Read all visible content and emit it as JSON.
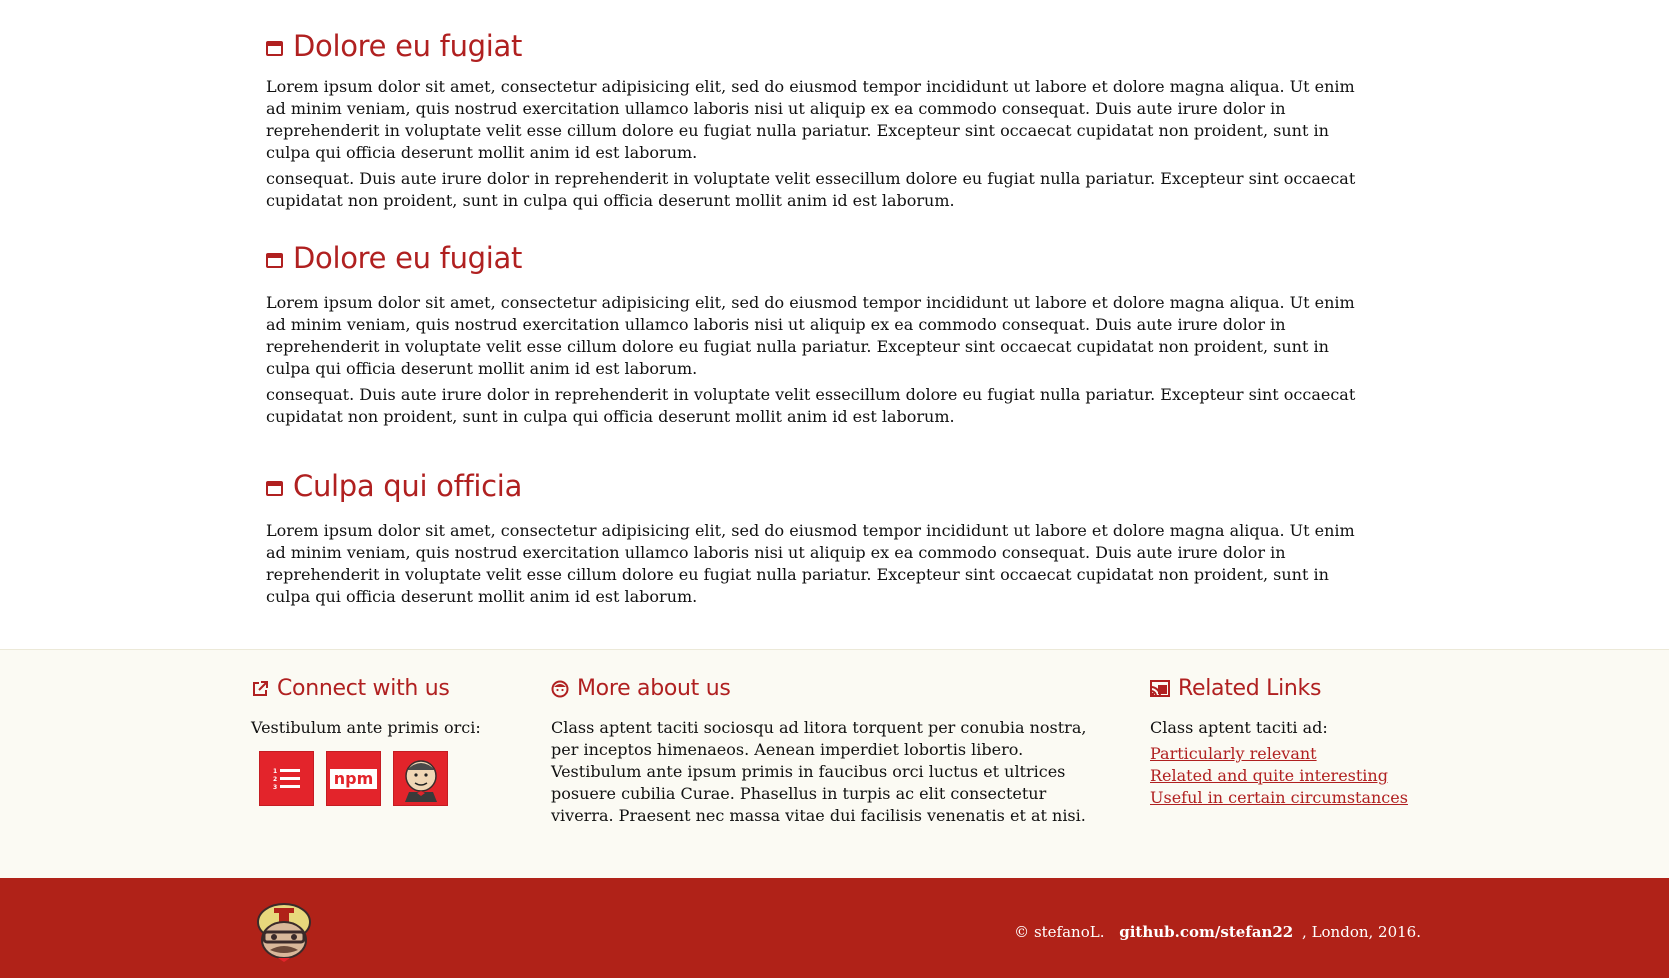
{
  "sections": [
    {
      "title": "Dolore eu fugiat",
      "paragraphs": [
        "Lorem ipsum dolor sit amet, consectetur adipisicing elit, sed do eiusmod tempor incididunt ut labore et dolore magna aliqua. Ut enim ad minim veniam, quis nostrud exercitation ullamco laboris nisi ut aliquip ex ea commodo consequat. Duis aute irure dolor in reprehenderit in voluptate velit esse cillum dolore eu fugiat nulla pariatur. Excepteur sint occaecat cupidatat non proident, sunt in culpa qui officia deserunt mollit anim id est laborum.",
        "consequat. Duis aute irure dolor in reprehenderit in voluptate velit essecillum dolore eu fugiat nulla pariatur. Excepteur sint occaecat cupidatat non proident, sunt in culpa qui officia deserunt mollit anim id est laborum."
      ]
    },
    {
      "title": "Dolore eu fugiat",
      "paragraphs": [
        "Lorem ipsum dolor sit amet, consectetur adipisicing elit, sed do eiusmod tempor incididunt ut labore et dolore magna aliqua. Ut enim ad minim veniam, quis nostrud exercitation ullamco laboris nisi ut aliquip ex ea commodo consequat. Duis aute irure dolor in reprehenderit in voluptate velit esse cillum dolore eu fugiat nulla pariatur. Excepteur sint occaecat cupidatat non proident, sunt in culpa qui officia deserunt mollit anim id est laborum.",
        "consequat. Duis aute irure dolor in reprehenderit in voluptate velit essecillum dolore eu fugiat nulla pariatur. Excepteur sint occaecat cupidatat non proident, sunt in culpa qui officia deserunt mollit anim id est laborum."
      ]
    },
    {
      "title": "Culpa qui officia",
      "paragraphs": [
        "Lorem ipsum dolor sit amet, consectetur adipisicing elit, sed do eiusmod tempor incididunt ut labore et dolore magna aliqua. Ut enim ad minim veniam, quis nostrud exercitation ullamco laboris nisi ut aliquip ex ea commodo consequat. Duis aute irure dolor in reprehenderit in voluptate velit esse cillum dolore eu fugiat nulla pariatur. Excepteur sint occaecat cupidatat non proident, sunt in culpa qui officia deserunt mollit anim id est laborum."
      ]
    }
  ],
  "footer": {
    "connect": {
      "title": "Connect with us",
      "icon": "external-link-icon",
      "text": "Vestibulum ante primis orci:",
      "social": [
        {
          "name": "list-numbered-icon",
          "label": ""
        },
        {
          "name": "npm-icon",
          "label": "npm"
        },
        {
          "name": "jenkins-icon",
          "label": ""
        }
      ]
    },
    "about": {
      "title": "More about us",
      "icon": "face-icon",
      "paragraphs": [
        "Class aptent taciti sociosqu ad litora torquent per conubia nostra, per inceptos himenaeos. Aenean imperdiet lobortis libero.",
        "Vestibulum ante ipsum primis in faucibus orci luctus et ultrices posuere cubilia Curae. Phasellus in turpis ac elit consectetur viverra. Praesent nec massa vitae dui facilisis venenatis et at nisi."
      ]
    },
    "related": {
      "title": "Related Links",
      "icon": "cast-icon",
      "text": "Class aptent taciti ad:",
      "links": [
        "Particularly relevant",
        "Related and quite interesting",
        "Useful in certain circumstances"
      ]
    },
    "bottom": {
      "copyright_prefix": "© stefanoL.",
      "github_link": "github.com/stefan22",
      "copyright_suffix": ", London, 2016."
    }
  },
  "colors": {
    "accent": "#b02020",
    "footer_bg": "#fbfaf3",
    "bottom_bar": "#b02218",
    "social_red": "#e3242b"
  }
}
